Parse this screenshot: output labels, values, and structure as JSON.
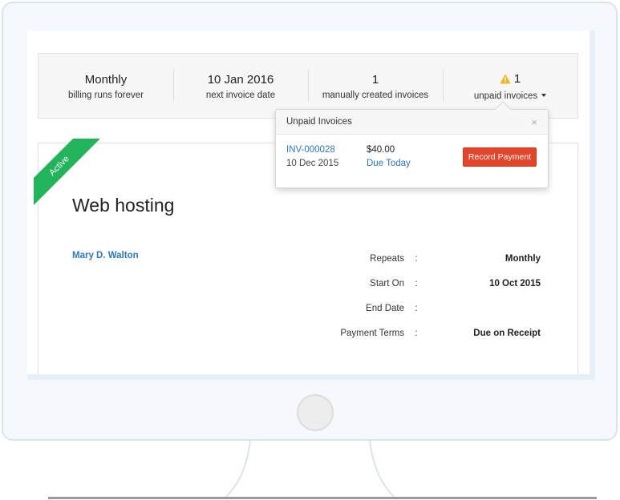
{
  "summary": {
    "billing": {
      "value": "Monthly",
      "label": "billing runs forever"
    },
    "next_invoice": {
      "value": "10 Jan 2016",
      "label": "next invoice date"
    },
    "manual_invoices": {
      "value": "1",
      "label": "manually created invoices"
    },
    "unpaid": {
      "value": "1",
      "label": "unpaid invoices",
      "icon": "warning-icon"
    }
  },
  "popover": {
    "title": "Unpaid Invoices",
    "close": "×",
    "invoice": {
      "number": "INV-000028",
      "date": "10 Dec 2015",
      "amount": "$40.00",
      "due": "Due Today"
    },
    "action_label": "Record Payment"
  },
  "card": {
    "status": "Active",
    "title": "Web hosting",
    "customer": "Mary D. Walton",
    "details": [
      {
        "label": "Repeats",
        "separator": ":",
        "value": "Monthly"
      },
      {
        "label": "Start On",
        "separator": ":",
        "value": "10 Oct 2015"
      },
      {
        "label": "End Date",
        "separator": ":",
        "value": ""
      },
      {
        "label": "Payment Terms",
        "separator": ":",
        "value": "Due on Receipt"
      }
    ]
  },
  "colors": {
    "accent_link": "#2a7ac0",
    "status_active": "#21b45a",
    "action_button": "#e2452a",
    "warning": "#f0b323"
  }
}
